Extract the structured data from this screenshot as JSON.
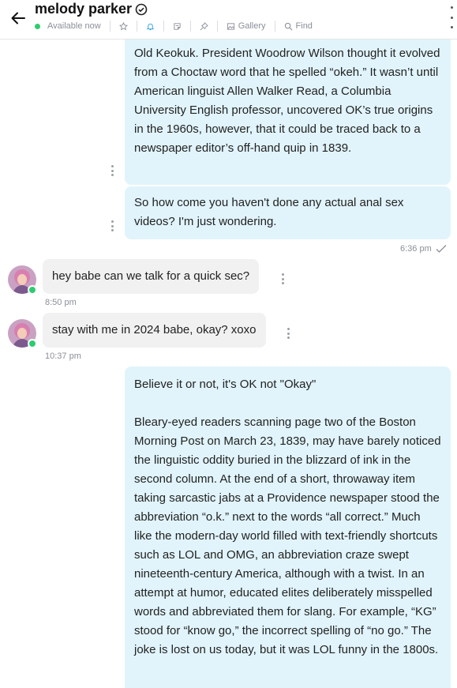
{
  "header": {
    "contact_name": "melody parker",
    "status": "Available now",
    "gallery_label": "Gallery",
    "find_label": "Find"
  },
  "messages": {
    "m1_text": "Old Keokuk. President Woodrow Wilson thought it evolved from a Choctaw word that he spelled “okeh.” It wasn’t until American linguist Allen Walker Read, a Columbia University English professor, uncovered OK’s true origins in the 1960s, however, that it could be traced back to a newspaper editor’s off-hand quip in 1839.",
    "m2_text": "So how come you haven't done any actual anal sex videos? I'm just wondering.",
    "m2_time": "6:36 pm",
    "m3_text": "hey babe can we talk for a quick sec?",
    "m3_time": "8:50 pm",
    "m4_text": "stay with me in 2024 babe, okay? xoxo",
    "m4_time": "10:37 pm",
    "m5_title": "Believe it or not, it's OK not \"Okay\"",
    "m5_body": "Bleary-eyed readers scanning page two of the Boston Morning Post on March 23, 1839, may have barely noticed the linguistic oddity buried in the blizzard of ink in the second column. At the end of a short, throwaway item taking sarcastic jabs at a Providence newspaper stood the abbreviation “o.k.” next to the words “all correct.” Much like the modern-day world filled with text-friendly shortcuts such as LOL and OMG, an abbreviation craze swept nineteenth-century America, although with a twist. In an attempt at humor, educated elites deliberately misspelled words and abbreviated them for slang. For example, “KG” stood for “know go,” the incorrect spelling of “no go.” The joke is lost on us today, but it was LOL funny in the 1800s."
  },
  "colors": {
    "outgoing_bubble": "#e1f4fb",
    "incoming_bubble": "#f1f1f1",
    "online": "#2ecc71",
    "accent": "#2a9fd6"
  }
}
